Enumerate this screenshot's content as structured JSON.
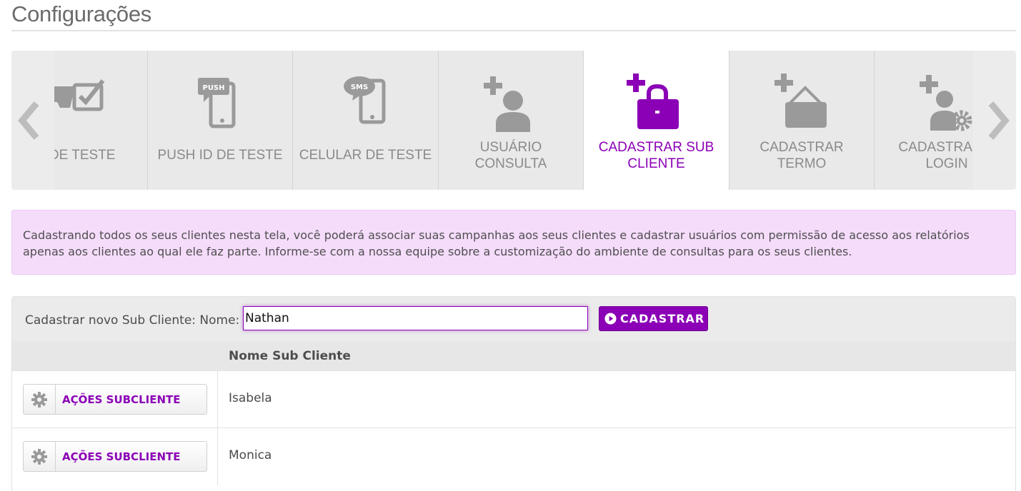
{
  "page": {
    "title": "Configurações"
  },
  "carousel": {
    "tiles": [
      {
        "label": "IL DE TESTE",
        "icon": "email-check-icon"
      },
      {
        "label": "PUSH ID DE TESTE",
        "icon": "push-phone-icon"
      },
      {
        "label": "CELULAR DE TESTE",
        "icon": "sms-phone-icon"
      },
      {
        "label_line1": "USUÁRIO",
        "label_line2": "CONSULTA",
        "icon": "add-user-icon"
      },
      {
        "label_line1": "CADASTRAR SUB",
        "label_line2": "CLIENTE",
        "icon": "add-briefcase-icon",
        "active": true
      },
      {
        "label_line1": "CADASTRAR",
        "label_line2": "TERMO",
        "icon": "add-sign-icon"
      },
      {
        "label_line1": "CADASTRAR S",
        "label_line2": "LOGIN",
        "icon": "add-user-gear-icon"
      }
    ]
  },
  "info": {
    "text": "Cadastrando todos os seus clientes nesta tela, você poderá associar suas campanhas aos seus clientes e cadastrar usuários com permissão de acesso aos relatórios apenas aos clientes ao qual ele faz parte. Informe-se com a nossa equipe sobre a customização do ambiente de consultas para os seus clientes."
  },
  "form": {
    "label": "Cadastrar novo Sub Cliente: Nome:",
    "name_value": "Nathan",
    "submit_label": "CADASTRAR"
  },
  "table": {
    "column_header": "Nome Sub Cliente",
    "rows": [
      {
        "action_label": "AÇÕES SUBCLIENTE",
        "name": "Isabela"
      },
      {
        "action_label": "AÇÕES SUBCLIENTE",
        "name": "Monica"
      }
    ]
  },
  "colors": {
    "accent": "#8b00b6",
    "info_bg": "#f5dcfb",
    "tile_bg": "#e9e9e9",
    "icon_gray": "#9a9a9a"
  }
}
